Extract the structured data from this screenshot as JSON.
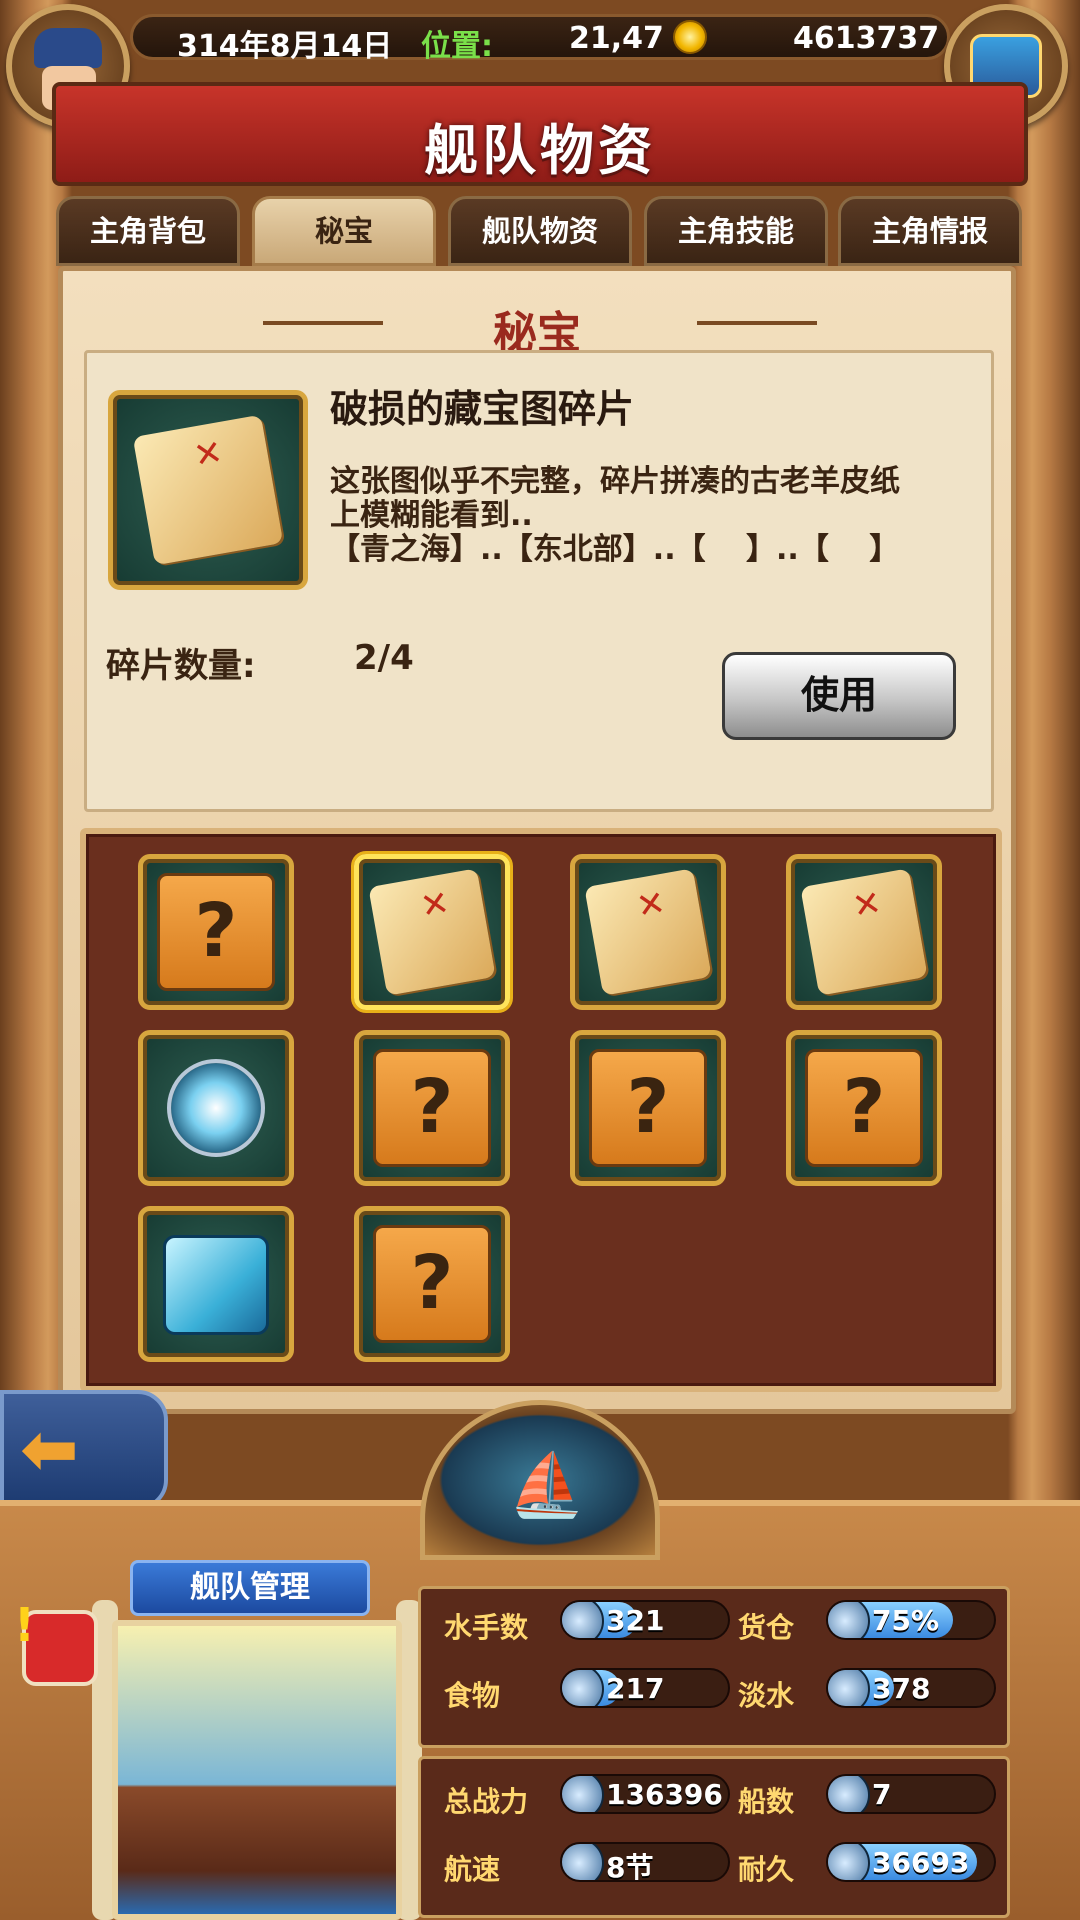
{
  "header": {
    "date": "314年8月14日",
    "location_label": "位置:",
    "location_value": "21,47",
    "gold": "4613737",
    "title": "舰队物资"
  },
  "tabs": [
    {
      "label": "主角背包",
      "active": false
    },
    {
      "label": "秘宝",
      "active": true
    },
    {
      "label": "舰队物资",
      "active": false
    },
    {
      "label": "主角技能",
      "active": false
    },
    {
      "label": "主角情报",
      "active": false
    }
  ],
  "section_title": "秘宝",
  "selected_item": {
    "name": "破损的藏宝图碎片",
    "description_lines": [
      "这张图似乎不完整，碎片拼凑的古老羊皮纸",
      "上模糊能看到..",
      "【青之海】..【东北部】..【　 】..【　 】"
    ],
    "count_label": "碎片数量:",
    "count_value": "2/4",
    "use_label": "使用"
  },
  "grid_items": [
    {
      "type": "unknown",
      "label": "?"
    },
    {
      "type": "map-fragment",
      "selected": true
    },
    {
      "type": "map-fragment"
    },
    {
      "type": "map-fragment"
    },
    {
      "type": "compass"
    },
    {
      "type": "unknown",
      "label": "?"
    },
    {
      "type": "unknown",
      "label": "?"
    },
    {
      "type": "unknown",
      "label": "?"
    },
    {
      "type": "ice-cube"
    },
    {
      "type": "unknown",
      "label": "?"
    }
  ],
  "fleet": {
    "tag": "舰队管理",
    "stats": [
      {
        "label": "水手数",
        "value": "321",
        "icon": "sailor-icon",
        "fill": 0.45
      },
      {
        "label": "货仓",
        "value": "75%",
        "icon": "crate-icon",
        "fill": 0.75
      },
      {
        "label": "食物",
        "value": "217",
        "icon": "meat-icon",
        "fill": 0.35
      },
      {
        "label": "淡水",
        "value": "378",
        "icon": "water-jug-icon",
        "fill": 0.4
      },
      {
        "label": "总战力",
        "value": "136396",
        "icon": "crossed-swords-icon",
        "fill": 0.0
      },
      {
        "label": "船数",
        "value": "7",
        "icon": "ship-icon",
        "fill": 0.0
      },
      {
        "label": "航速",
        "value": "8节",
        "icon": "sail-icon",
        "fill": 0.0
      },
      {
        "label": "耐久",
        "value": "36693",
        "icon": "hull-icon",
        "fill": 0.9
      }
    ]
  },
  "colors": {
    "accent_red": "#b02820",
    "gold": "#f2b600",
    "bar_blue": "#3a8ae0"
  }
}
